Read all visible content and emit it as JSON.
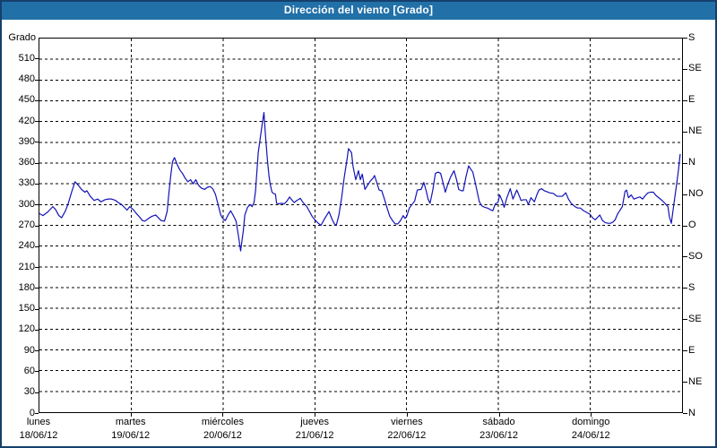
{
  "window": {
    "title": "Dirección del viento [Grado]"
  },
  "colors": {
    "title_bar": "#2170a8",
    "outer_border": "#15406b",
    "line": "#1212b8",
    "grid": "#000000",
    "plot_background": "#ffffff",
    "title_text": "#ffffff"
  },
  "chart_data": {
    "type": "line",
    "title": "Dirección del viento [Grado]",
    "xlabel": "",
    "ylabel": "Grado",
    "ylim": [
      0,
      540
    ],
    "xlim": [
      0,
      168
    ],
    "x_unit": "hours since lunes 18/06/12 00:00",
    "grid": true,
    "legend": "none",
    "left_ticks": [
      0,
      30,
      60,
      90,
      120,
      150,
      180,
      210,
      240,
      270,
      300,
      330,
      360,
      390,
      420,
      450,
      480,
      510
    ],
    "right_ticks": [
      {
        "deg": 0,
        "label": "N"
      },
      {
        "deg": 45,
        "label": "NE"
      },
      {
        "deg": 90,
        "label": "E"
      },
      {
        "deg": 135,
        "label": "SE"
      },
      {
        "deg": 180,
        "label": "S"
      },
      {
        "deg": 225,
        "label": "SO"
      },
      {
        "deg": 270,
        "label": "O"
      },
      {
        "deg": 315,
        "label": "NO"
      },
      {
        "deg": 360,
        "label": "N"
      },
      {
        "deg": 405,
        "label": "NE"
      },
      {
        "deg": 450,
        "label": "E"
      },
      {
        "deg": 495,
        "label": "SE"
      },
      {
        "deg": 540,
        "label": "S"
      }
    ],
    "days": [
      {
        "name": "lunes",
        "date": "18/06/12"
      },
      {
        "name": "martes",
        "date": "19/06/12"
      },
      {
        "name": "miércoles",
        "date": "20/06/12"
      },
      {
        "name": "jueves",
        "date": "21/06/12"
      },
      {
        "name": "viernes",
        "date": "22/06/12"
      },
      {
        "name": "sábado",
        "date": "23/06/12"
      },
      {
        "name": "domingo",
        "date": "24/06/12"
      }
    ],
    "series": [
      {
        "name": "Dirección del viento",
        "points": [
          [
            0,
            287
          ],
          [
            0.9,
            284
          ],
          [
            2.1,
            289
          ],
          [
            3.5,
            297
          ],
          [
            4.2,
            293
          ],
          [
            5.1,
            284
          ],
          [
            5.8,
            281
          ],
          [
            6.8,
            291
          ],
          [
            7.5,
            301
          ],
          [
            8.4,
            318
          ],
          [
            9.3,
            333
          ],
          [
            10.3,
            327
          ],
          [
            11,
            322
          ],
          [
            11.9,
            318
          ],
          [
            12.4,
            320
          ],
          [
            13.3,
            312
          ],
          [
            14.3,
            306
          ],
          [
            15.2,
            308
          ],
          [
            16.1,
            304
          ],
          [
            17.1,
            307
          ],
          [
            18,
            308
          ],
          [
            18.9,
            308
          ],
          [
            19.9,
            306
          ],
          [
            20.6,
            303
          ],
          [
            21.5,
            300
          ],
          [
            22.2,
            296
          ],
          [
            22.9,
            292
          ],
          [
            23.6,
            297
          ],
          [
            24.5,
            293
          ],
          [
            25.2,
            288
          ],
          [
            26.2,
            282
          ],
          [
            26.9,
            277
          ],
          [
            27.6,
            276
          ],
          [
            28.5,
            280
          ],
          [
            29.4,
            283
          ],
          [
            30.4,
            285
          ],
          [
            31.1,
            281
          ],
          [
            31.8,
            277
          ],
          [
            32.7,
            276
          ],
          [
            33.4,
            290
          ],
          [
            33.9,
            320
          ],
          [
            34.4,
            345
          ],
          [
            34.8,
            362
          ],
          [
            35.3,
            368
          ],
          [
            36,
            358
          ],
          [
            36.7,
            350
          ],
          [
            37.4,
            345
          ],
          [
            38.1,
            338
          ],
          [
            38.8,
            333
          ],
          [
            39.5,
            336
          ],
          [
            40.2,
            330
          ],
          [
            40.9,
            336
          ],
          [
            41.6,
            328
          ],
          [
            42.3,
            324
          ],
          [
            43.2,
            322
          ],
          [
            43.9,
            325
          ],
          [
            44.6,
            326
          ],
          [
            45.3,
            323
          ],
          [
            46,
            315
          ],
          [
            46.7,
            300
          ],
          [
            47.4,
            285
          ],
          [
            47.9,
            280
          ],
          [
            48.6,
            277
          ],
          [
            49.3,
            285
          ],
          [
            50,
            291
          ],
          [
            50.7,
            284
          ],
          [
            51.4,
            276
          ],
          [
            52.1,
            252
          ],
          [
            52.6,
            233
          ],
          [
            53.3,
            262
          ],
          [
            53.7,
            285
          ],
          [
            54.4,
            296
          ],
          [
            55.1,
            300
          ],
          [
            55.6,
            297
          ],
          [
            56.1,
            303
          ],
          [
            56.5,
            320
          ],
          [
            57.2,
            375
          ],
          [
            58.2,
            415
          ],
          [
            58.7,
            433
          ],
          [
            59.1,
            400
          ],
          [
            59.6,
            364
          ],
          [
            60,
            342
          ],
          [
            60.3,
            330
          ],
          [
            60.8,
            318
          ],
          [
            61.2,
            316
          ],
          [
            61.7,
            315
          ],
          [
            62,
            302
          ],
          [
            62.6,
            301
          ],
          [
            63.3,
            302
          ],
          [
            64,
            301
          ],
          [
            64.7,
            305
          ],
          [
            65.4,
            311
          ],
          [
            66.1,
            306
          ],
          [
            66.6,
            303
          ],
          [
            67.3,
            306
          ],
          [
            68.2,
            309
          ],
          [
            68.9,
            303
          ],
          [
            69.9,
            297
          ],
          [
            70.6,
            290
          ],
          [
            71.3,
            283
          ],
          [
            72,
            278
          ],
          [
            72.9,
            273
          ],
          [
            73.6,
            270
          ],
          [
            74.5,
            279
          ],
          [
            75.7,
            290
          ],
          [
            76.4,
            280
          ],
          [
            77.1,
            272
          ],
          [
            77.6,
            270
          ],
          [
            78.3,
            285
          ],
          [
            79,
            310
          ],
          [
            79.7,
            340
          ],
          [
            80.4,
            365
          ],
          [
            80.8,
            381
          ],
          [
            81.6,
            375
          ],
          [
            82,
            355
          ],
          [
            82.7,
            336
          ],
          [
            83.4,
            349
          ],
          [
            83.9,
            336
          ],
          [
            84.4,
            344
          ],
          [
            85.1,
            322
          ],
          [
            85.8,
            328
          ],
          [
            86.5,
            334
          ],
          [
            87.2,
            338
          ],
          [
            87.6,
            342
          ],
          [
            88.3,
            330
          ],
          [
            88.8,
            321
          ],
          [
            89.5,
            320
          ],
          [
            90.2,
            308
          ],
          [
            90.9,
            295
          ],
          [
            91.6,
            283
          ],
          [
            92.3,
            277
          ],
          [
            93,
            272
          ],
          [
            93.7,
            272
          ],
          [
            94.4,
            277
          ],
          [
            95.1,
            284
          ],
          [
            95.6,
            280
          ],
          [
            96,
            283
          ],
          [
            96.7,
            295
          ],
          [
            97.4,
            300
          ],
          [
            98.1,
            305
          ],
          [
            98.8,
            321
          ],
          [
            99.8,
            322
          ],
          [
            100.5,
            332
          ],
          [
            101.2,
            318
          ],
          [
            101.6,
            308
          ],
          [
            102.1,
            302
          ],
          [
            102.8,
            320
          ],
          [
            103.5,
            345
          ],
          [
            104.2,
            347
          ],
          [
            104.9,
            345
          ],
          [
            105.6,
            330
          ],
          [
            106.1,
            318
          ],
          [
            106.8,
            330
          ],
          [
            107.5,
            340
          ],
          [
            108,
            345
          ],
          [
            108.4,
            349
          ],
          [
            109.1,
            335
          ],
          [
            109.6,
            322
          ],
          [
            110.3,
            320
          ],
          [
            110.8,
            320
          ],
          [
            111.5,
            340
          ],
          [
            112.2,
            356
          ],
          [
            112.9,
            350
          ],
          [
            113.3,
            347
          ],
          [
            114,
            330
          ],
          [
            115,
            304
          ],
          [
            115.7,
            298
          ],
          [
            116.4,
            296
          ],
          [
            117.1,
            295
          ],
          [
            117.8,
            293
          ],
          [
            118.5,
            291
          ],
          [
            119.2,
            301
          ],
          [
            119.9,
            303
          ],
          [
            120.3,
            314
          ],
          [
            121,
            305
          ],
          [
            121.5,
            296
          ],
          [
            122.2,
            310
          ],
          [
            123.1,
            323
          ],
          [
            123.8,
            308
          ],
          [
            124.8,
            321
          ],
          [
            125.5,
            312
          ],
          [
            125.9,
            306
          ],
          [
            126.6,
            307
          ],
          [
            127.3,
            307
          ],
          [
            127.8,
            300
          ],
          [
            128.5,
            310
          ],
          [
            129.4,
            304
          ],
          [
            130.1,
            315
          ],
          [
            130.6,
            321
          ],
          [
            131.3,
            323
          ],
          [
            132,
            320
          ],
          [
            132.5,
            319
          ],
          [
            133.4,
            317
          ],
          [
            134.4,
            316
          ],
          [
            135.3,
            312
          ],
          [
            136,
            312
          ],
          [
            136.7,
            312
          ],
          [
            137.6,
            317
          ],
          [
            138.3,
            308
          ],
          [
            139,
            302
          ],
          [
            140,
            297
          ],
          [
            140.7,
            295
          ],
          [
            141.4,
            295
          ],
          [
            142.3,
            291
          ],
          [
            143,
            289
          ],
          [
            143.9,
            286
          ],
          [
            144.6,
            281
          ],
          [
            145.3,
            278
          ],
          [
            146,
            282
          ],
          [
            146.5,
            285
          ],
          [
            147.2,
            277
          ],
          [
            147.9,
            274
          ],
          [
            148.6,
            273
          ],
          [
            149.3,
            273
          ],
          [
            150,
            275
          ],
          [
            150.5,
            278
          ],
          [
            151.2,
            287
          ],
          [
            151.7,
            291
          ],
          [
            152.4,
            297
          ],
          [
            153.1,
            319
          ],
          [
            153.5,
            321
          ],
          [
            154,
            310
          ],
          [
            154.7,
            314
          ],
          [
            155.4,
            308
          ],
          [
            156.3,
            310
          ],
          [
            157,
            311
          ],
          [
            157.7,
            308
          ],
          [
            158.4,
            313
          ],
          [
            159.1,
            317
          ],
          [
            159.8,
            318
          ],
          [
            160.5,
            318
          ],
          [
            161.2,
            313
          ],
          [
            161.9,
            310
          ],
          [
            162.8,
            306
          ],
          [
            163.5,
            302
          ],
          [
            164.3,
            297
          ],
          [
            164.7,
            282
          ],
          [
            165.2,
            273
          ],
          [
            165.9,
            302
          ],
          [
            166.6,
            330
          ],
          [
            167.1,
            351
          ],
          [
            167.5,
            373
          ]
        ]
      }
    ]
  }
}
